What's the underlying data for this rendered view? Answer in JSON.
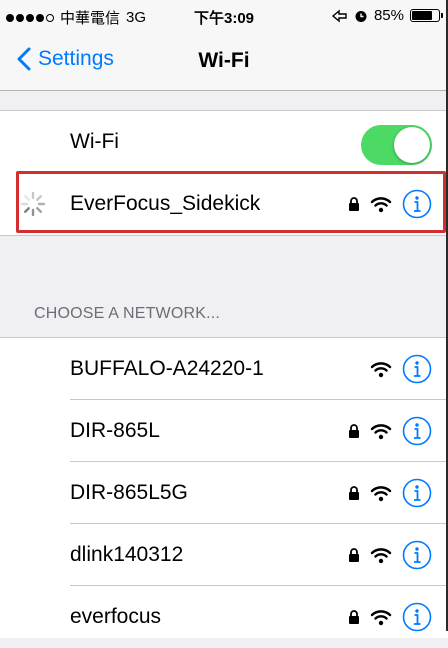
{
  "status_bar": {
    "carrier": "中華電信",
    "network": "3G",
    "time": "下午3:09",
    "battery": "85%",
    "battery_level": 0.85,
    "signal_bars_filled": 4,
    "signal_bars_total": 5
  },
  "nav": {
    "back_label": "Settings",
    "title": "Wi-Fi"
  },
  "wifi_toggle": {
    "label": "Wi-Fi",
    "on": true
  },
  "connecting_network": {
    "name": "EverFocus_Sidekick",
    "locked": true,
    "status": "connecting"
  },
  "section_header": "CHOOSE A NETWORK...",
  "networks": [
    {
      "name": "BUFFALO-A24220-1",
      "locked": false
    },
    {
      "name": "DIR-865L",
      "locked": true
    },
    {
      "name": "DIR-865L5G",
      "locked": true
    },
    {
      "name": "dlink140312",
      "locked": true
    },
    {
      "name": "everfocus",
      "locked": true
    }
  ],
  "colors": {
    "accent": "#007aff",
    "switch_on": "#4cd964",
    "highlight": "#d32f2f",
    "section_header": "#6d6d72"
  }
}
